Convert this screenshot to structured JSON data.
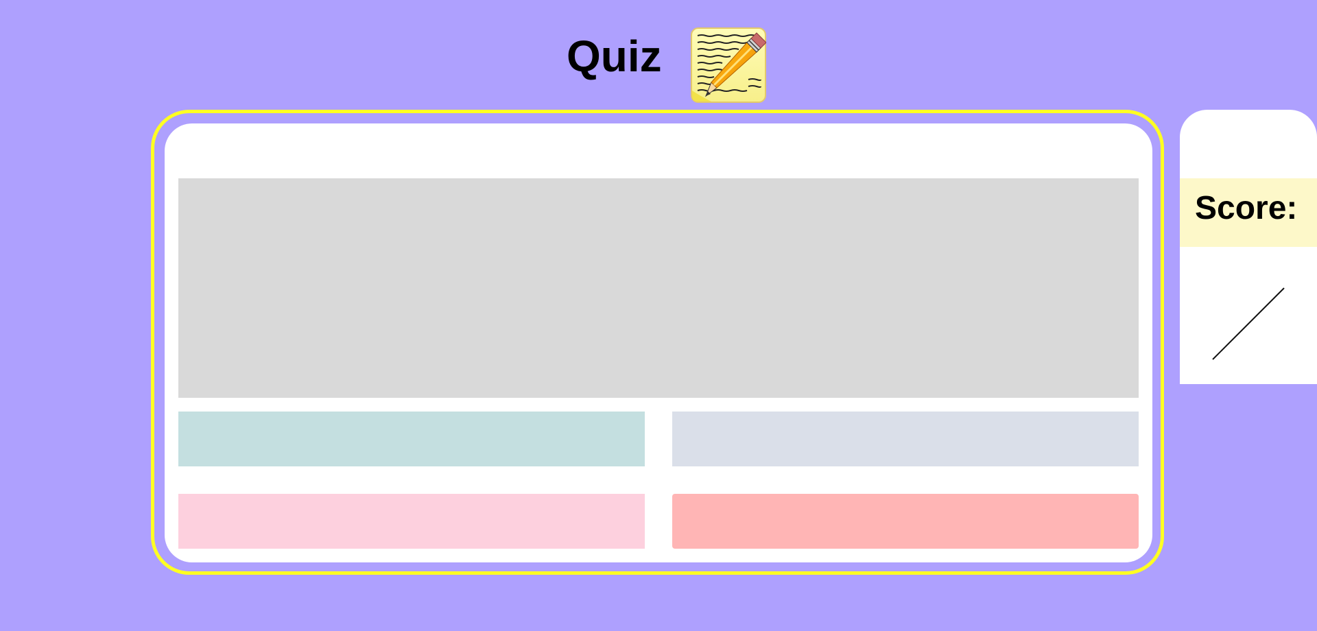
{
  "header": {
    "title": "Quiz",
    "icon": "notepad-pencil-icon"
  },
  "quiz": {
    "question_text": "",
    "answers": [
      "",
      "",
      "",
      ""
    ],
    "answer_colors": [
      "#c4dfe0",
      "#dadfe9",
      "#fdd0de",
      "#ffb5b5"
    ],
    "frame_color": "#ffff22"
  },
  "score": {
    "label": "Score:",
    "correct": "",
    "total": "",
    "divider_icon": "fraction-slash-icon",
    "band_color": "#fdf8c9"
  },
  "colors": {
    "background": "#aea0fe",
    "card": "#ffffff",
    "question_area": "#d9d9d9"
  }
}
